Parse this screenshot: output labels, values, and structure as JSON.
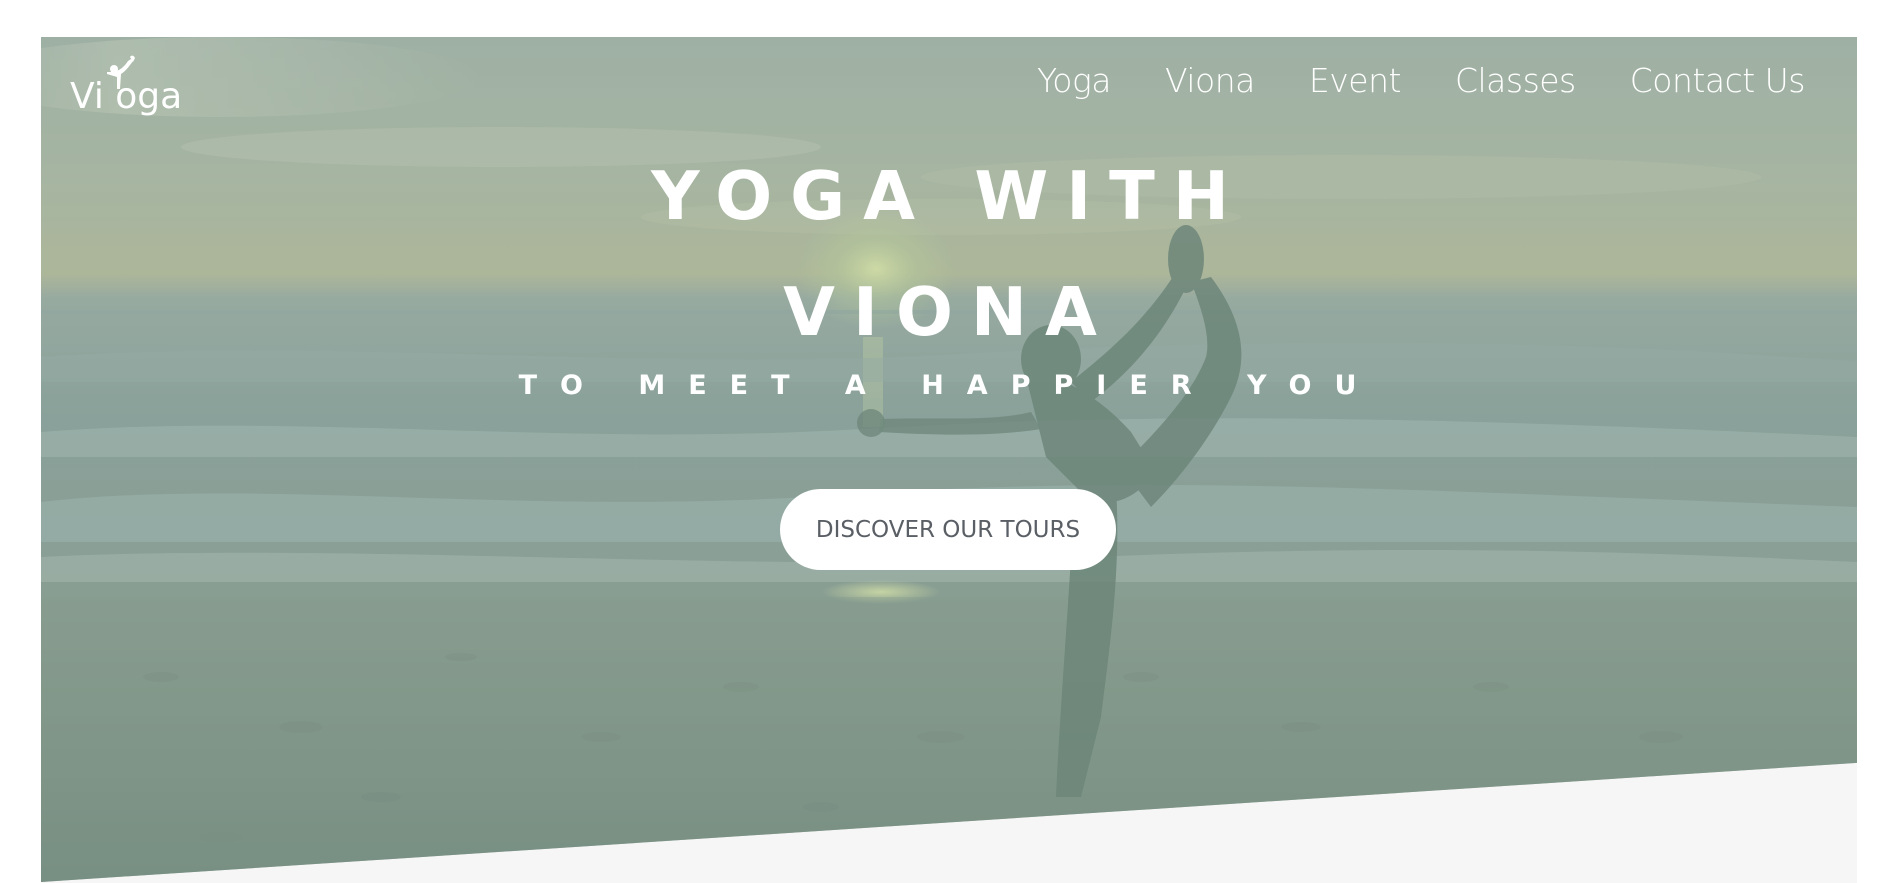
{
  "brand": {
    "logo_text": "Vi oga",
    "logo_icon": "yoga-pose-icon"
  },
  "nav": {
    "items": [
      {
        "label": "Yoga"
      },
      {
        "label": "Viona"
      },
      {
        "label": "Event"
      },
      {
        "label": "Classes"
      },
      {
        "label": "Contact Us"
      }
    ]
  },
  "hero": {
    "headline_line1": "YOGA WITH",
    "headline_line2": "VIONA",
    "subheadline": "TO MEET A HAPPIER YOU",
    "cta_label": "DISCOVER OUR TOURS",
    "background_description_color": "#9fb3a9"
  },
  "colors": {
    "accent_text": "#5a5f66",
    "hero_tint": "#7b968a",
    "footer_band": "#f6f6f6"
  }
}
